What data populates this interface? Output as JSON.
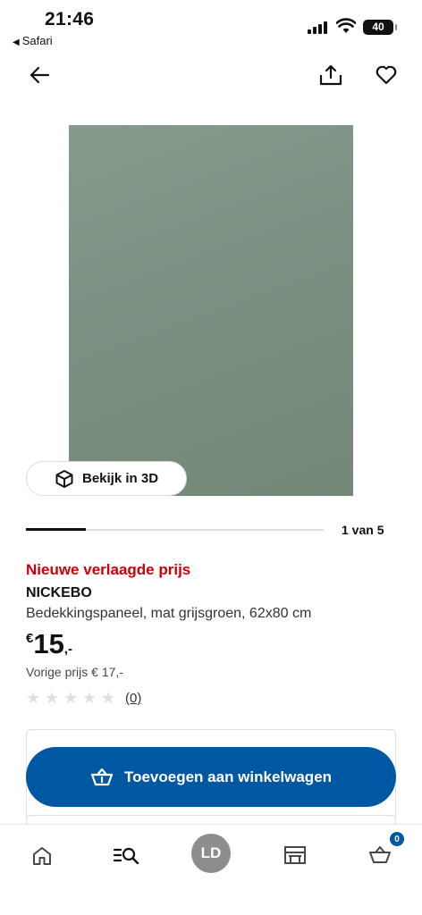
{
  "status_bar": {
    "time": "21:46",
    "back_app": "Safari",
    "battery": "40"
  },
  "product": {
    "image_color": "#7d9083",
    "view_3d_label": "Bekijk in 3D",
    "pager": {
      "current": 1,
      "total": 5,
      "text": "1 van 5"
    },
    "badge": "Nieuwe verlaagde prijs",
    "name": "NICKEBO",
    "description": "Bedekkingspaneel, mat grijsgroen, 62x80 cm",
    "price": {
      "currency": "€",
      "integer": "15",
      "decimal": ",-"
    },
    "previous_price": "Vorige prijs € 17,-",
    "rating": {
      "stars": 0,
      "max": 5,
      "count": "(0)"
    }
  },
  "cta": {
    "label": "Toevoegen aan winkelwagen"
  },
  "tab_bar": {
    "avatar_initials": "LD",
    "basket_badge": "0"
  },
  "colors": {
    "accent": "#0058a3",
    "sale": "#cc0008"
  },
  "icons": [
    "arrow-left-icon",
    "share-icon",
    "heart-icon",
    "cube-3d-icon",
    "star-icon",
    "basket-icon",
    "home-icon",
    "search-menu-icon",
    "store-icon"
  ]
}
